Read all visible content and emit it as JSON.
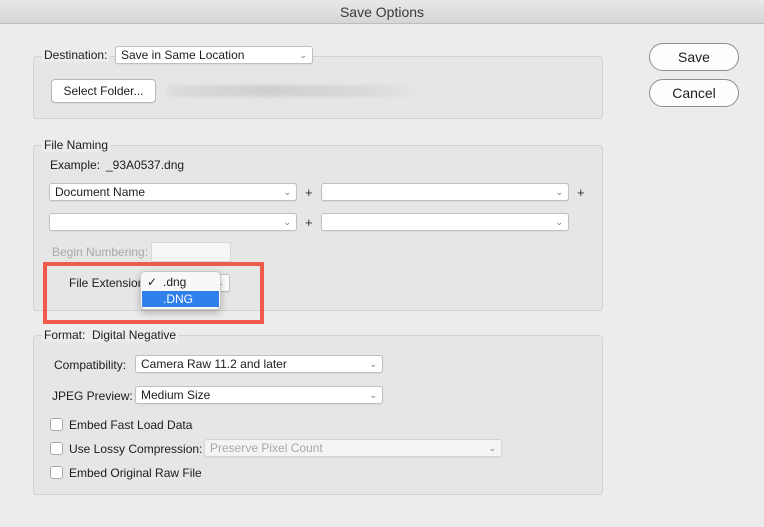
{
  "window": {
    "title": "Save Options"
  },
  "buttons": {
    "save": "Save",
    "cancel": "Cancel"
  },
  "destination": {
    "label": "Destination:",
    "selected": "Save in Same Location",
    "select_folder": "Select Folder..."
  },
  "file_naming": {
    "legend": "File Naming",
    "example_label": "Example:",
    "example_value": "_93A0537.dng",
    "row1": {
      "left": "Document Name",
      "right": ""
    },
    "row2": {
      "left": "",
      "right": ""
    },
    "plus": "+",
    "begin_numbering": "Begin Numbering:",
    "file_extension": "File Extension",
    "extension_options": [
      {
        "label": ".dng",
        "checked": true
      },
      {
        "label": ".DNG",
        "highlighted": true
      }
    ],
    "check_mark": "✓"
  },
  "format": {
    "label": "Format:",
    "value": "Digital Negative",
    "compatibility_label": "Compatibility:",
    "compatibility_value": "Camera Raw 11.2 and later",
    "jpeg_preview_label": "JPEG Preview:",
    "jpeg_preview_value": "Medium Size",
    "embed_fast_load": "Embed Fast Load Data",
    "use_lossy": "Use Lossy Compression:",
    "lossy_value": "Preserve Pixel Count",
    "embed_original": "Embed Original Raw File"
  },
  "icons": {
    "chevron": "⌄"
  },
  "colors": {
    "highlight": "#f05a4a",
    "selection": "#2f80ed"
  }
}
